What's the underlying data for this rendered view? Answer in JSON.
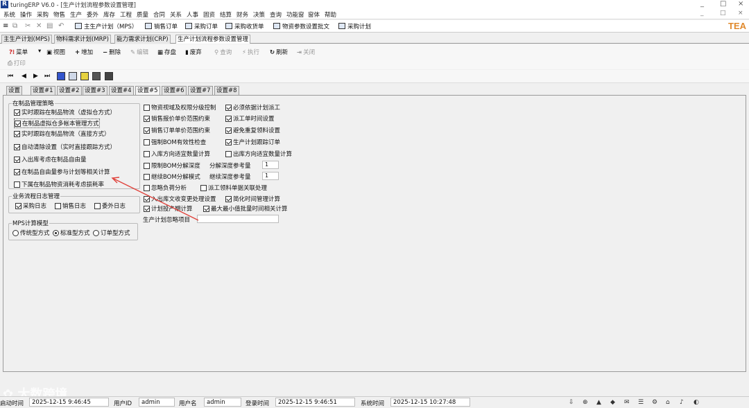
{
  "title": "turingERP V6.0 - [生产计划流程参数设置管理]",
  "window_controls": {
    "minimize": "_",
    "restore": "□",
    "close": "×",
    "mdi_minimize": "_",
    "mdi_restore": "□",
    "mdi_close": "×"
  },
  "menu": [
    "系统",
    "操作",
    "采购",
    "物售",
    "生产",
    "委外",
    "库存",
    "工程",
    "质量",
    "合同",
    "关系",
    "人事",
    "固资",
    "结算",
    "财务",
    "决策",
    "查询",
    "功能窗",
    "窗体",
    "帮助"
  ],
  "quick": {
    "items": [
      "主生产计划（MPS）",
      "销售订单",
      "采购订单",
      "采购收货单",
      "物资参数设置批文",
      "采购计划"
    ],
    "brand": "TEA"
  },
  "doc_tabs": [
    "主生产计划(MPS)",
    "物料需求计划(MRP)",
    "能力需求计划(CRP)",
    "生产计划流程参数设置管理"
  ],
  "toolbar": {
    "menu": "菜单",
    "view": "视图",
    "add": "增加",
    "delete": "删除",
    "edit": "编辑",
    "save": "存盘",
    "discard": "废弃",
    "query": "查询",
    "execute": "执行",
    "refresh": "刷新",
    "close": "关闭",
    "print": "打印"
  },
  "nav": {
    "first": "⏮",
    "prev": "◀",
    "next": "▶",
    "last": "⏭"
  },
  "settings_tabs": [
    "设置",
    "设置#1",
    "设置#2",
    "设置#3",
    "设置#4",
    "设置#5",
    "设置#6",
    "设置#7",
    "设置#8"
  ],
  "wip_group": {
    "title": "在制品管理策略",
    "items": [
      {
        "label": "实时跟踪在制品物流（虚拟仓方式）",
        "checked": true
      },
      {
        "label": "在制品虚拟仓多帐本管理方式",
        "checked": true
      },
      {
        "label": "实时跟踪在制品物流（直接方式）",
        "checked": true
      },
      {
        "label": "自动清除设置（实时直接跟踪方式）",
        "checked": true
      },
      {
        "label": "入出库考虑在制品自由量",
        "checked": true
      },
      {
        "label": "在制品自由量参与计划等相关计算",
        "checked": true
      },
      {
        "label": "下属在制品物资消耗考虑损耗率",
        "checked": false
      }
    ]
  },
  "log_group": {
    "title": "业务流程日志管理",
    "items": [
      {
        "label": "采购日志",
        "checked": true
      },
      {
        "label": "销售日志",
        "checked": false
      },
      {
        "label": "委外日志",
        "checked": false
      }
    ]
  },
  "mps_group": {
    "title": "MPS计算模型",
    "items": [
      {
        "label": "传统型方式",
        "selected": false
      },
      {
        "label": "标准型方式",
        "selected": true
      },
      {
        "label": "订单型方式",
        "selected": false
      }
    ]
  },
  "right": {
    "c1": [
      {
        "label": "物资视域及权限分级控制",
        "checked": false
      },
      {
        "label": "销售报价单价范围约束",
        "checked": true
      },
      {
        "label": "销售订单单价范围约束",
        "checked": true
      },
      {
        "label": "强制BOM有效性检查",
        "checked": false
      },
      {
        "label": "入库方向适宜数量计算",
        "checked": false
      },
      {
        "label": "限制BOM分解深度",
        "checked": false
      },
      {
        "label": "继续BOM分解模式",
        "checked": false
      },
      {
        "label": "忽略负荷分析",
        "checked": false
      },
      {
        "label": "入出库文收变更处理设置",
        "checked": true
      },
      {
        "label": "计划投产期计算",
        "checked": true
      }
    ],
    "c2": [
      {
        "label": "必须依据计划派工",
        "checked": true
      },
      {
        "label": "派工单时间设置",
        "checked": true
      },
      {
        "label": "避免重复领料设置",
        "checked": true
      },
      {
        "label": "生产计划跟踪订单",
        "checked": true
      },
      {
        "label": "出库方向适宜数量计算",
        "checked": false
      },
      {
        "label": "派工领料单据关联处理",
        "checked": false
      },
      {
        "label": "简化时间管理计算",
        "checked": true
      },
      {
        "label": "最大最小值批量时间相关计算",
        "checked": true
      }
    ],
    "depth_ref_label": "分解深度参考量",
    "depth_ref_value": "1",
    "cont_ref_label": "继续深度参考量",
    "cont_ref_value": "1",
    "ignore_label": "生产计划忽略项目"
  },
  "status": {
    "login_label": "启动时间",
    "login_value": "2025-12-15 9:46:45",
    "userid_label": "用户ID",
    "userid_value": "admin",
    "username_label": "用户名",
    "username_value": "admin",
    "logtime_label": "登录时间",
    "logtime_value": "2025-12-15 9:46:51",
    "systime_label": "系统时间",
    "systime_value": "2025-12-15 10:27:48"
  },
  "watermark": "大数跨境",
  "colors": {
    "accent": "#1b3f8f",
    "brand": "#e0892c",
    "annotation": "#e0413a"
  }
}
